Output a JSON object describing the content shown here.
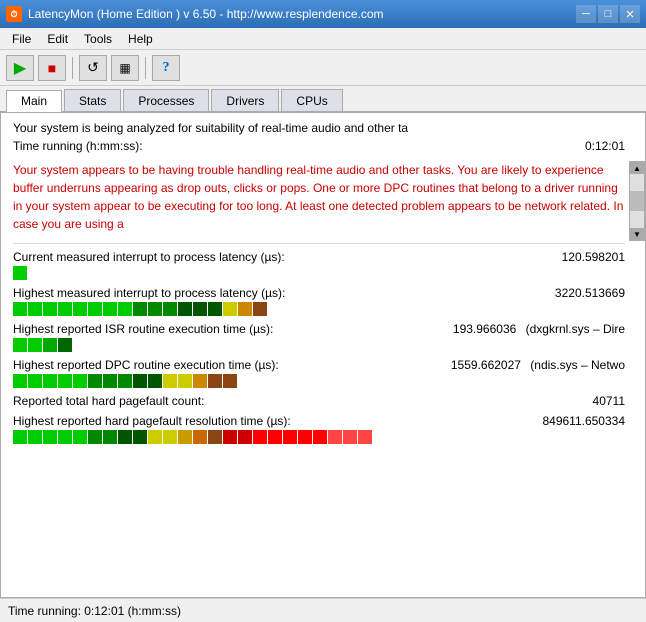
{
  "window": {
    "title": "LatencyMon (Home Edition )  v 6.50 - http://www.resplendence.com",
    "icon": "L"
  },
  "title_controls": {
    "minimize": "─",
    "maximize": "□",
    "close": "✕"
  },
  "menu": {
    "items": [
      "File",
      "Edit",
      "Tools",
      "Help"
    ]
  },
  "toolbar": {
    "buttons": [
      "▶",
      "■",
      "↺",
      "⬜",
      "?"
    ]
  },
  "tabs": {
    "items": [
      "Main",
      "Stats",
      "Processes",
      "Drivers",
      "CPUs"
    ],
    "active": 0
  },
  "main": {
    "status_line1": "Your system is being analyzed for suitability of real-time audio and other ta",
    "status_line2_label": "Time running (h:mm:ss):",
    "status_line2_value": "0:12:01",
    "warning": "Your system appears to be having trouble handling real-time audio and other tasks. You are likely to experience buffer underruns appearing as drop outs, clicks or pops. One or more DPC routines that belong to a driver running in your system appear to be executing for too long. At least one detected problem appears to be network related. In case you are using a",
    "metrics": [
      {
        "label": "Current measured interrupt to process latency (µs):",
        "value": "120.598201",
        "extra": "",
        "bar_green": 2,
        "bar_yellow": 0,
        "bar_orange": 0,
        "bar_red": 0,
        "bar_type": "low"
      },
      {
        "label": "Highest measured interrupt to process latency (µs):",
        "value": "3220.513669",
        "extra": "",
        "bar_green": 16,
        "bar_yellow": 2,
        "bar_orange": 2,
        "bar_red": 0,
        "bar_type": "high"
      },
      {
        "label": "Highest reported ISR routine execution time (µs):",
        "value": "193.966036",
        "extra": "(dxgkrnl.sys – Dire",
        "bar_green": 4,
        "bar_yellow": 0,
        "bar_orange": 0,
        "bar_red": 0,
        "bar_type": "medium-low"
      },
      {
        "label": "Highest reported DPC routine execution time (µs):",
        "value": "1559.662027",
        "extra": "(ndis.sys – Netwo",
        "bar_green": 12,
        "bar_yellow": 3,
        "bar_orange": 1,
        "bar_red": 0,
        "bar_type": "medium-high"
      },
      {
        "label": "Reported total hard pagefault count:",
        "value": "40711",
        "extra": "",
        "bar_type": "none"
      },
      {
        "label": "Highest reported hard pagefault resolution time (µs):",
        "value": "849611.650334",
        "extra": "",
        "bar_green": 10,
        "bar_yellow": 4,
        "bar_orange": 4,
        "bar_red": 8,
        "bar_type": "very-high"
      }
    ]
  },
  "status_bar": {
    "text": "Time running: 0:12:01  (h:mm:ss)"
  },
  "colors": {
    "green_bright": "#00cc00",
    "green_dark": "#006600",
    "yellow": "#cccc00",
    "orange": "#cc6600",
    "red_bright": "#ff0000",
    "red_dark": "#cc0000",
    "brown": "#8b4513"
  }
}
